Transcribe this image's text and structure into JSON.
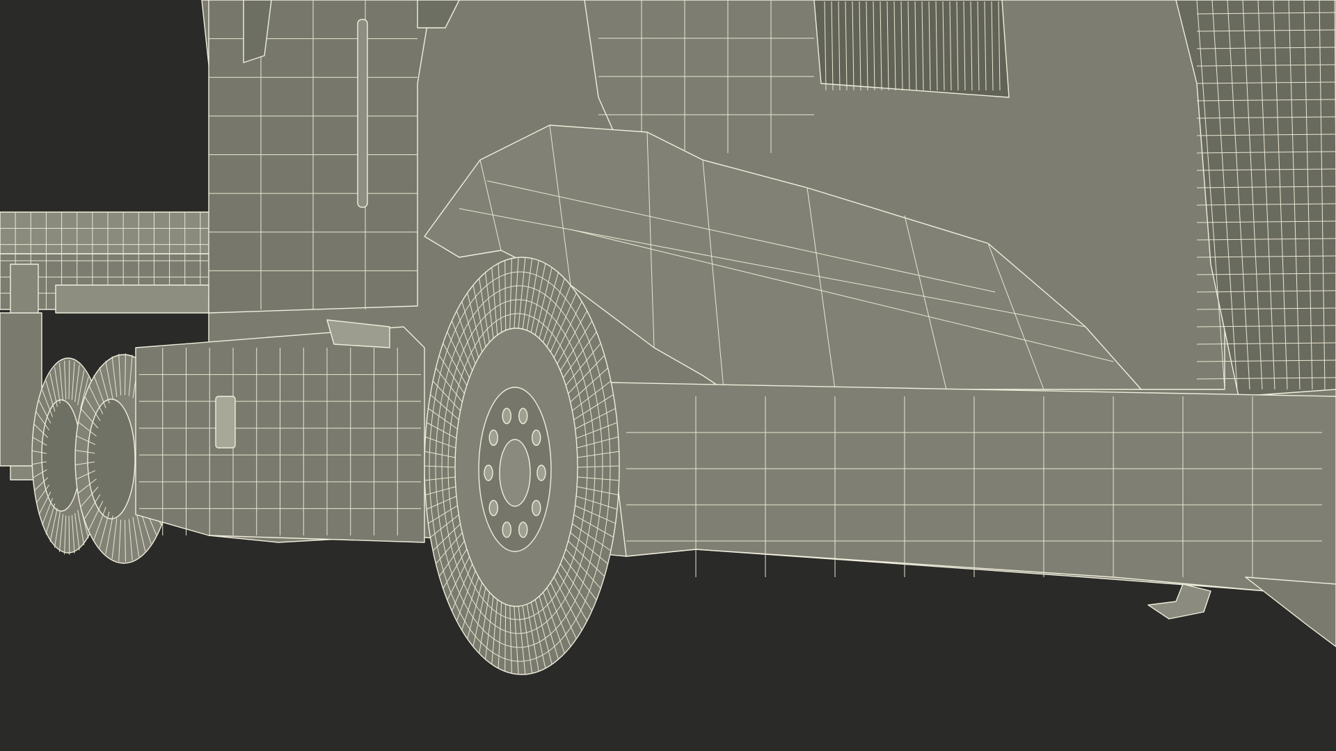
{
  "scene": {
    "subject": "semi-truck-tractor-wireframe-render",
    "colors": {
      "background": "#2a2a28",
      "surface": "#7a7b6d",
      "surface_shadow": "#6d6e61",
      "wire": "#f1eedd"
    }
  }
}
